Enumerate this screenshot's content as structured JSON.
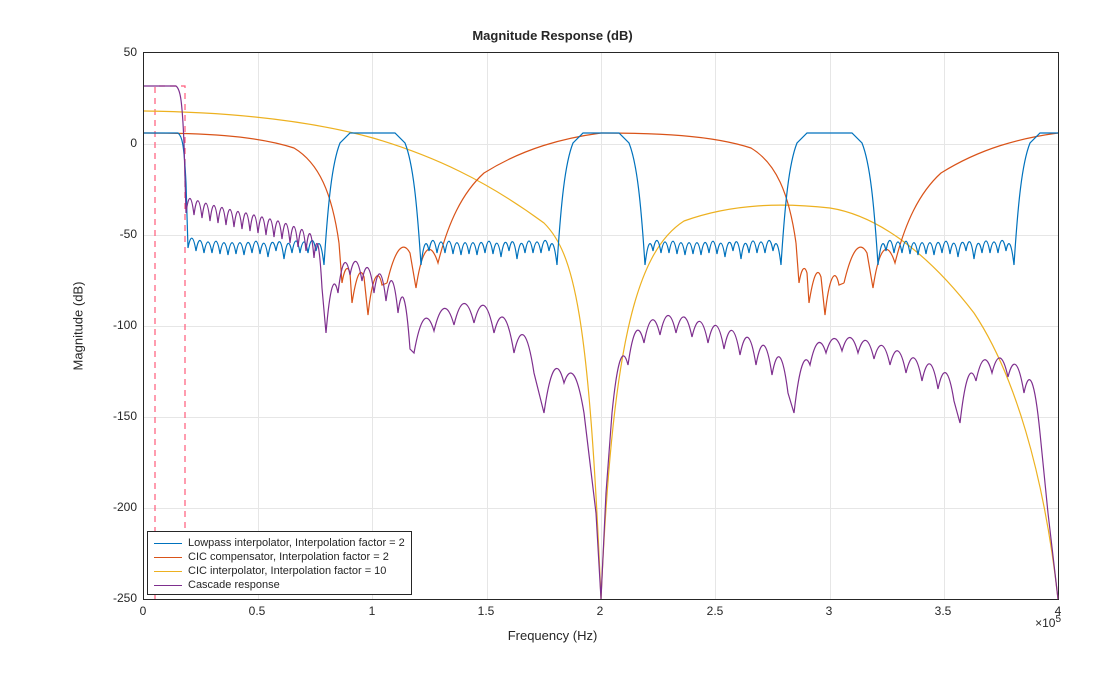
{
  "chart_data": {
    "type": "line",
    "title": "Magnitude Response (dB)",
    "xlabel": "Frequency (Hz)",
    "ylabel": "Magnitude (dB)",
    "x_exponent": "×10",
    "x_exponent_sup": "5",
    "xlim": [
      0,
      400000
    ],
    "ylim": [
      -250,
      50
    ],
    "xticks": [
      0,
      50000,
      100000,
      150000,
      200000,
      250000,
      300000,
      350000,
      400000
    ],
    "xtick_labels": [
      "0",
      "0.5",
      "1",
      "1.5",
      "2",
      "2.5",
      "3",
      "3.5",
      "4"
    ],
    "yticks": [
      -250,
      -200,
      -150,
      -100,
      -50,
      0,
      50
    ],
    "ytick_labels": [
      "-250",
      "-200",
      "-150",
      "-100",
      "-50",
      "0",
      "50"
    ],
    "mask": {
      "x": [
        5000,
        5000,
        18000,
        18000
      ],
      "y": [
        -250,
        32,
        32,
        -250
      ]
    },
    "series": [
      {
        "name": "Lowpass interpolator, Interpolation factor = 2",
        "color": "#0072BD",
        "period": 200000,
        "note": "Periodic lowpass spectral image with passband plateau approx +6 dB near multiples of 200000 and stopband ripple lobes approx -45 to -65 dB in between"
      },
      {
        "name": "CIC compensator, Interpolation factor = 2",
        "color": "#D95319",
        "period": 200000,
        "note": "Compensator response periodic every 200000, passband approx +6 dB near 0 and 200000 and 400000, transition notches with lobes down to approx -70 dB near 100000 and 300000"
      },
      {
        "name": "CIC interpolator, Interpolation factor = 10",
        "color": "#EDB120",
        "note": "Sinc-shaped CIC response approx +18 dB at DC rolling off with deep nulls near 200000 and 400000, intermediate lobe peak approx -33 dB near 280000"
      },
      {
        "name": "Cascade response",
        "color": "#7E2F8E",
        "note": "Overall cascade approx +32 dB passband 0 to 17000 then stopband with decreasing ripple lobes from approx -25 dB trending down past -100 dB with deep notches near 200000 and 400000"
      }
    ],
    "legend_position": "lower-left"
  }
}
